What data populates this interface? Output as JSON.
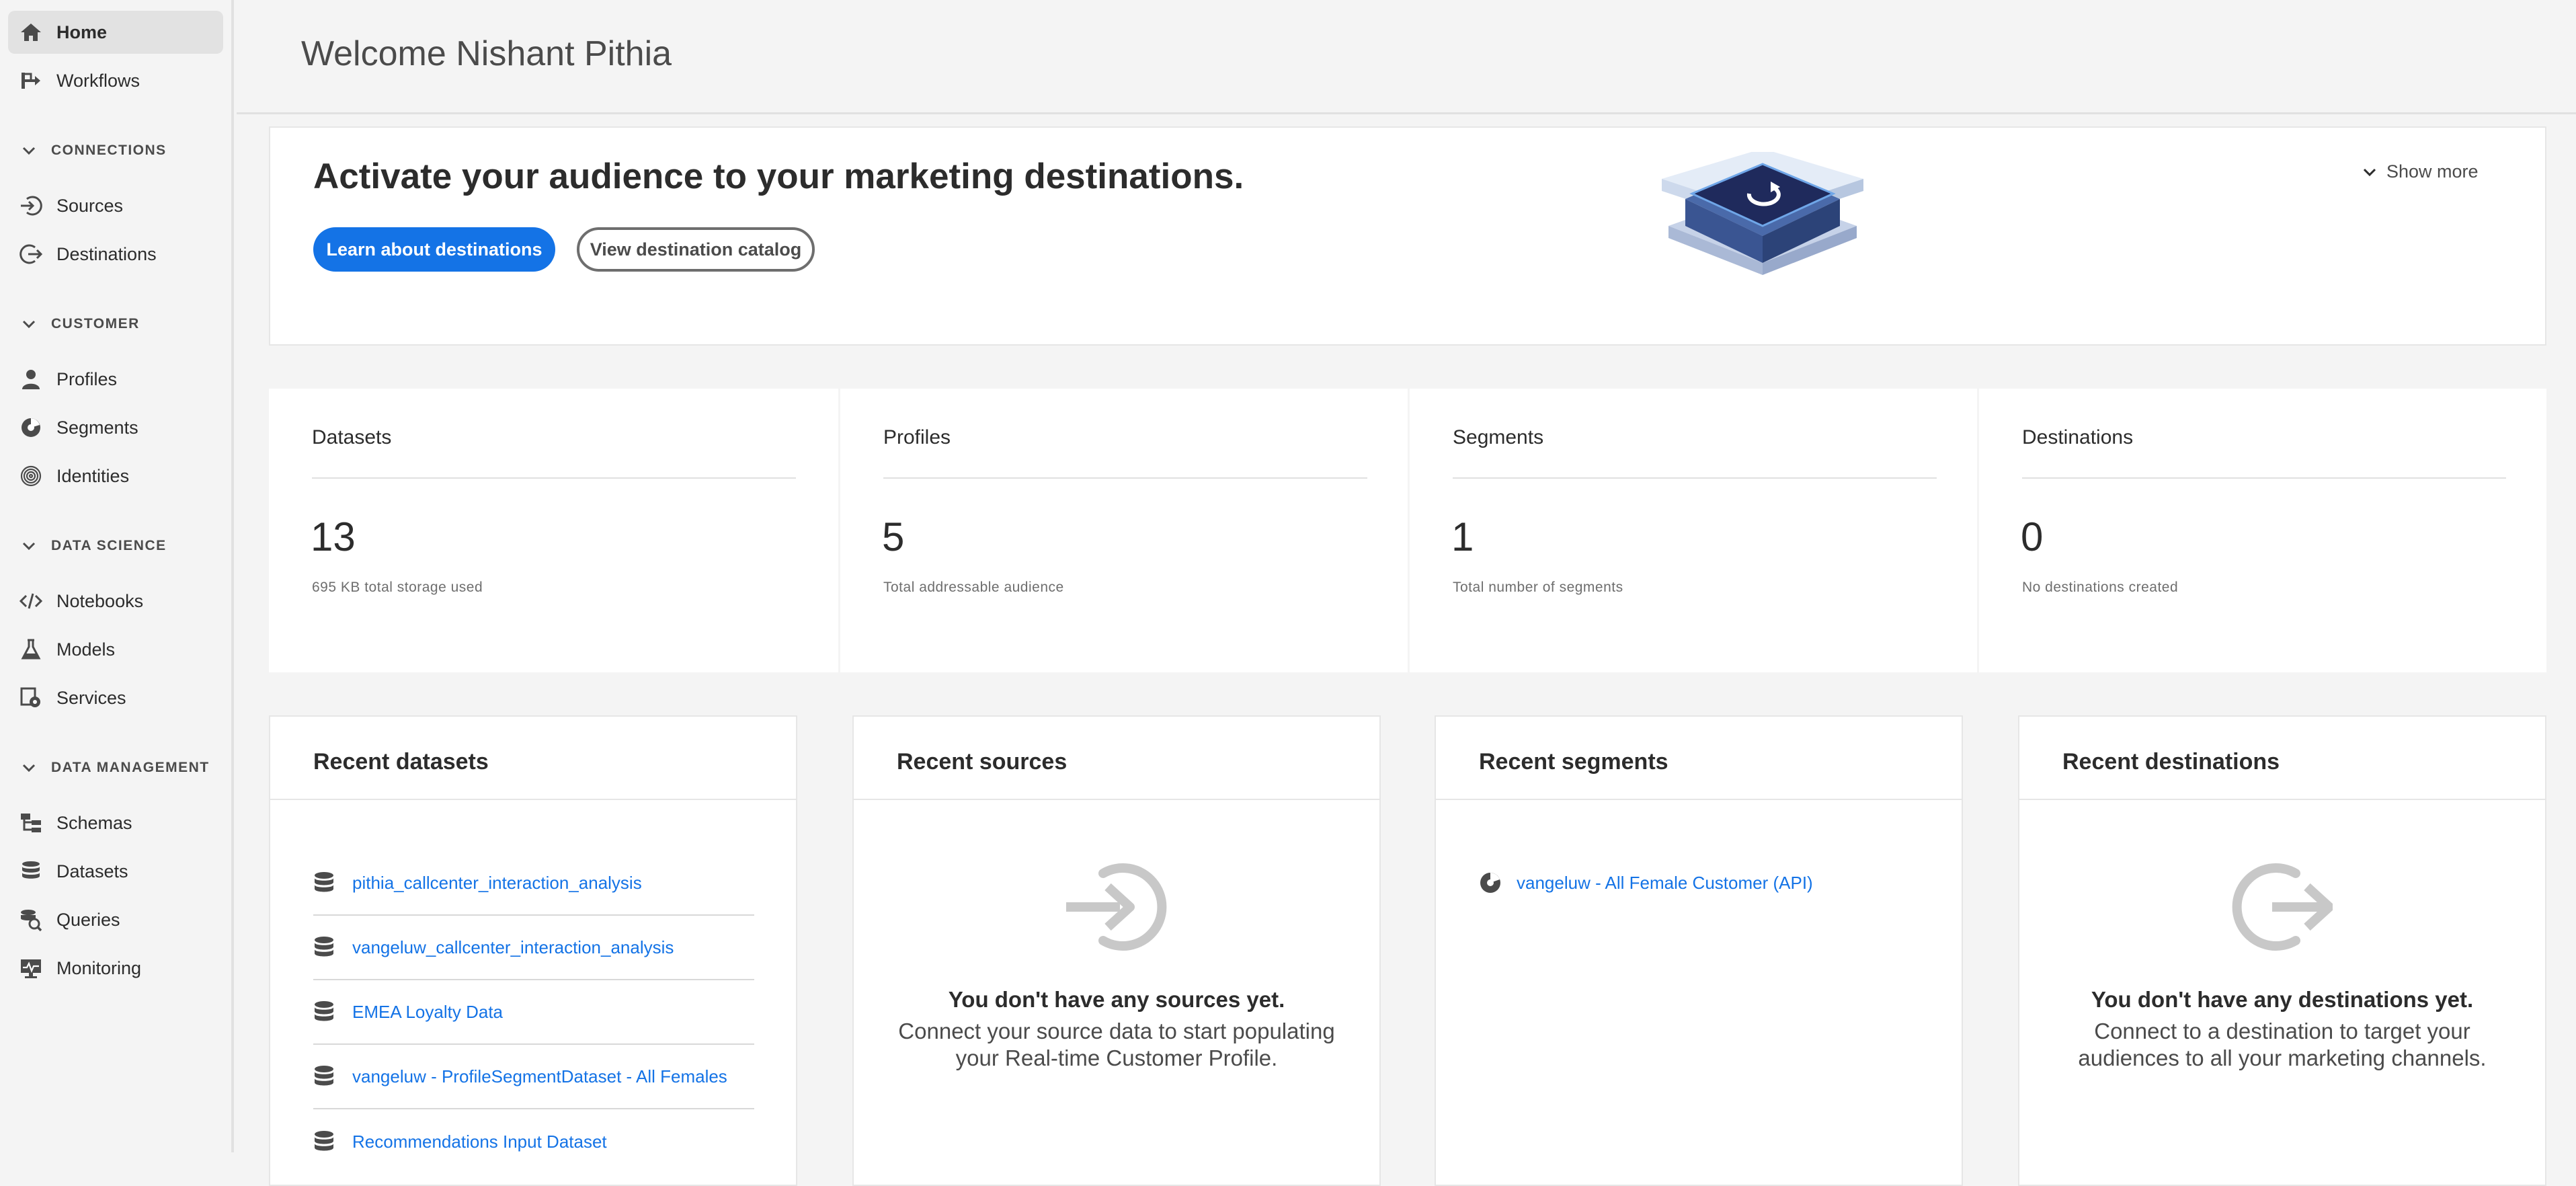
{
  "sidebar": {
    "home": "Home",
    "workflows": "Workflows",
    "connections_header": "CONNECTIONS",
    "sources": "Sources",
    "destinations": "Destinations",
    "customer_header": "CUSTOMER",
    "profiles": "Profiles",
    "segments": "Segments",
    "identities": "Identities",
    "data_science_header": "DATA SCIENCE",
    "notebooks": "Notebooks",
    "models": "Models",
    "services": "Services",
    "data_management_header": "DATA MANAGEMENT",
    "schemas": "Schemas",
    "datasets": "Datasets",
    "queries": "Queries",
    "monitoring": "Monitoring"
  },
  "header": {
    "welcome": "Welcome Nishant Pithia"
  },
  "banner": {
    "title": "Activate your audience to your marketing destinations.",
    "primary_button": "Learn about destinations",
    "secondary_button": "View destination catalog",
    "show_more": "Show more"
  },
  "stats": [
    {
      "label": "Datasets",
      "value": "13",
      "caption": "695 KB total storage used"
    },
    {
      "label": "Profiles",
      "value": "5",
      "caption": "Total addressable audience"
    },
    {
      "label": "Segments",
      "value": "1",
      "caption": "Total number of segments"
    },
    {
      "label": "Destinations",
      "value": "0",
      "caption": "No destinations created"
    }
  ],
  "recent_datasets": {
    "title": "Recent datasets",
    "items": [
      "pithia_callcenter_interaction_analysis",
      "vangeluw_callcenter_interaction_analysis",
      "EMEA Loyalty Data",
      "vangeluw - ProfileSegmentDataset - All Females",
      "Recommendations Input Dataset"
    ]
  },
  "recent_sources": {
    "title": "Recent sources",
    "empty_title": "You don't have any sources yet.",
    "empty_text_1": "Connect your source data to start populating",
    "empty_text_2": "your Real-time Customer Profile."
  },
  "recent_segments": {
    "title": "Recent segments",
    "items": [
      "vangeluw - All Female Customer (API)"
    ]
  },
  "recent_destinations": {
    "title": "Recent destinations",
    "empty_title": "You don't have any destinations yet.",
    "empty_text_1": "Connect to a destination to target your",
    "empty_text_2": "audiences to all your marketing channels."
  },
  "colors": {
    "accent": "#1473e6",
    "background": "#f4f4f4",
    "card": "#ffffff",
    "hero_dark": "#1f2a5c"
  },
  "icons": [
    "home-icon",
    "workflows-icon",
    "chevron-down-icon",
    "sources-icon",
    "destinations-icon",
    "profile-icon",
    "segments-icon",
    "identities-icon",
    "notebooks-icon",
    "models-icon",
    "services-icon",
    "schemas-icon",
    "datasets-icon",
    "queries-icon",
    "monitoring-icon",
    "database-icon",
    "arrow-in-icon",
    "arrow-out-icon"
  ]
}
